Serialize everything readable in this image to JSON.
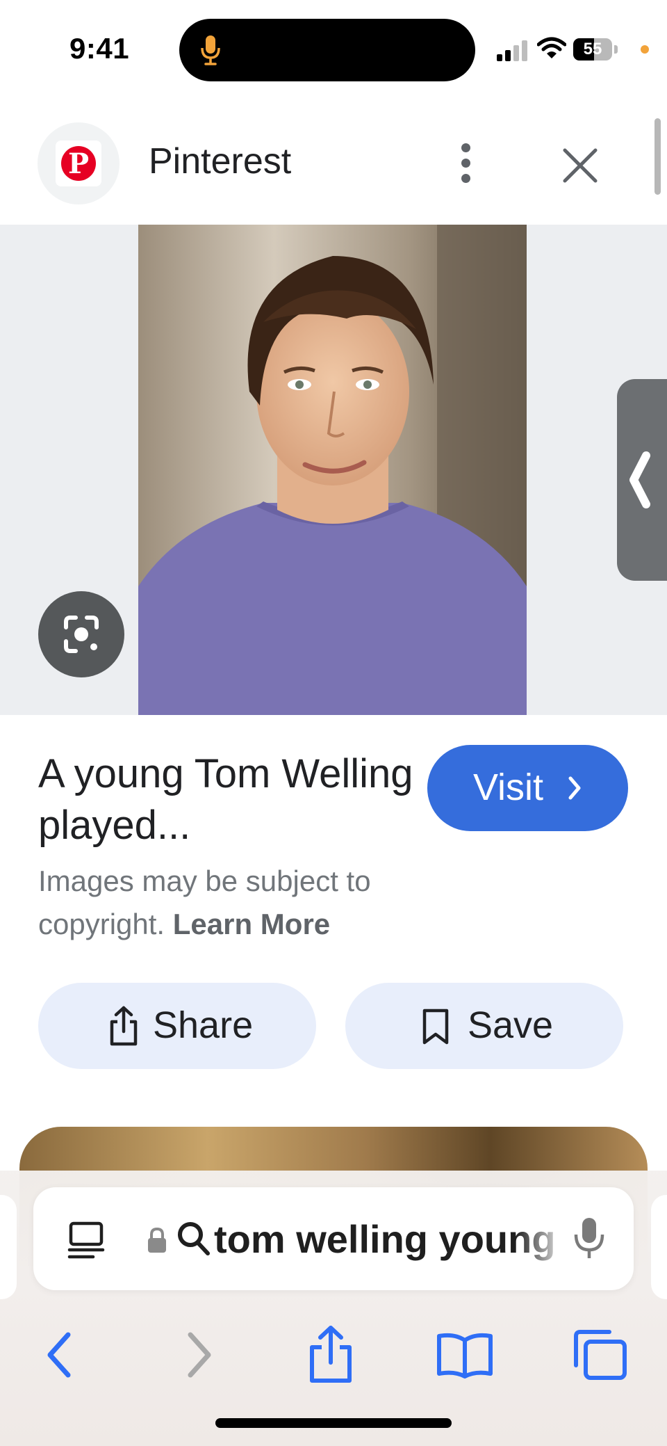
{
  "status_bar": {
    "time": "9:41",
    "battery": "55",
    "icons": [
      "mic-icon",
      "signal-icon",
      "wifi-icon",
      "battery-icon",
      "privacy-dot"
    ]
  },
  "header": {
    "site_name": "Pinterest",
    "logo_icon": "pinterest-logo",
    "menu_icon": "more-vert-icon",
    "close_icon": "close-icon"
  },
  "result": {
    "title": "A young Tom Welling played...",
    "visit_label": "Visit",
    "copyright_text": "Images may be subject to copyright.",
    "learn_more_label": "Learn More",
    "share_label": "Share",
    "save_label": "Save",
    "lens_icon": "google-lens-icon"
  },
  "browser": {
    "query": "tom welling young",
    "icons": [
      "reader-icon",
      "lock-icon",
      "search-icon",
      "mic-icon",
      "back-icon",
      "forward-icon",
      "share-icon",
      "bookmarks-icon",
      "tabs-icon"
    ]
  },
  "colors": {
    "visit_button": "#356ddc",
    "pill_bg": "#e8eefb",
    "pinterest_red": "#e60023",
    "ios_blue": "#2f6ef6"
  }
}
